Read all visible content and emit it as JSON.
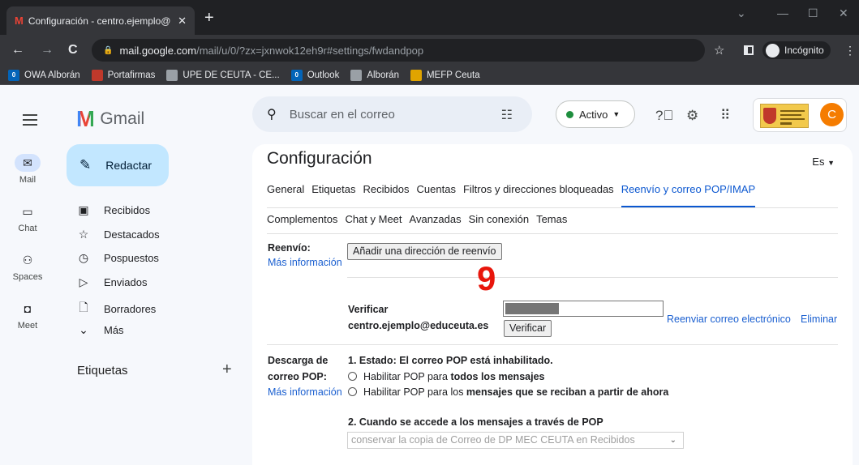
{
  "browser": {
    "tab_title": "Configuración - centro.ejemplo@",
    "tab_close": "✕",
    "new_tab": "+",
    "url_host": "mail.google.com",
    "url_path": "/mail/u/0/?zx=jxnwok12eh9r#settings/fwdandpop",
    "incognito_label": "Incógnito",
    "bookmarks": [
      {
        "label": "OWA Alborán",
        "color": "#0364b8",
        "badge": "0"
      },
      {
        "label": "Portafirmas",
        "color": "#c0392b",
        "badge": ""
      },
      {
        "label": "UPE DE CEUTA - CE...",
        "color": "#9aa0a6",
        "badge": ""
      },
      {
        "label": "Outlook",
        "color": "#0364b8",
        "badge": "0"
      },
      {
        "label": "Alborán",
        "color": "#9aa0a6",
        "badge": ""
      },
      {
        "label": "MEFP Ceuta",
        "color": "#e0a400",
        "badge": ""
      }
    ]
  },
  "gmail": {
    "logo_text": "Gmail",
    "search_placeholder": "Buscar en el correo",
    "status_label": "Activo",
    "avatar_letter": "C",
    "rail": [
      {
        "label": "Mail",
        "icon": "mail-icon"
      },
      {
        "label": "Chat",
        "icon": "chat-icon"
      },
      {
        "label": "Spaces",
        "icon": "spaces-icon"
      },
      {
        "label": "Meet",
        "icon": "meet-icon"
      }
    ],
    "compose_label": "Redactar",
    "nav": [
      {
        "label": "Recibidos",
        "icon": "inbox-icon"
      },
      {
        "label": "Destacados",
        "icon": "star-icon"
      },
      {
        "label": "Pospuestos",
        "icon": "clock-icon"
      },
      {
        "label": "Enviados",
        "icon": "send-icon"
      },
      {
        "label": "Borradores",
        "icon": "draft-icon"
      },
      {
        "label": "Más",
        "icon": "chevron-down-icon"
      }
    ],
    "labels_heading": "Etiquetas",
    "labels_add": "+"
  },
  "settings": {
    "title": "Configuración",
    "lang": "Es",
    "tabs_row1": [
      "General",
      "Etiquetas",
      "Recibidos",
      "Cuentas",
      "Filtros y direcciones bloqueadas",
      "Reenvío y correo POP/IMAP"
    ],
    "tabs_row2": [
      "Complementos",
      "Chat y Meet",
      "Avanzadas",
      "Sin conexión",
      "Temas"
    ],
    "forward_label": "Reenvío:",
    "more_info": "Más información",
    "add_forward_button": "Añadir una dirección de reenvío",
    "annotation": "9",
    "verify_label": "Verificar",
    "verify_email": "centro.ejemplo@educeuta.es",
    "verify_button": "Verificar",
    "resend_link": "Reenviar correo electrónico",
    "delete_link": "Eliminar",
    "pop_label_1": "Descarga de",
    "pop_label_2": "correo POP:",
    "pop_status": "1. Estado: El correo POP está inhabilitado.",
    "pop_opt1_pre": "Habilitar POP para ",
    "pop_opt1_bold": "todos los mensajes",
    "pop_opt2_pre": "Habilitar POP para los ",
    "pop_opt2_bold": "mensajes que se reciban a partir de ahora",
    "pop_access_heading": "2. Cuando se accede a los mensajes a través de POP",
    "pop_access_select": "conservar la copia de Correo de DP MEC CEUTA en Recibidos"
  }
}
